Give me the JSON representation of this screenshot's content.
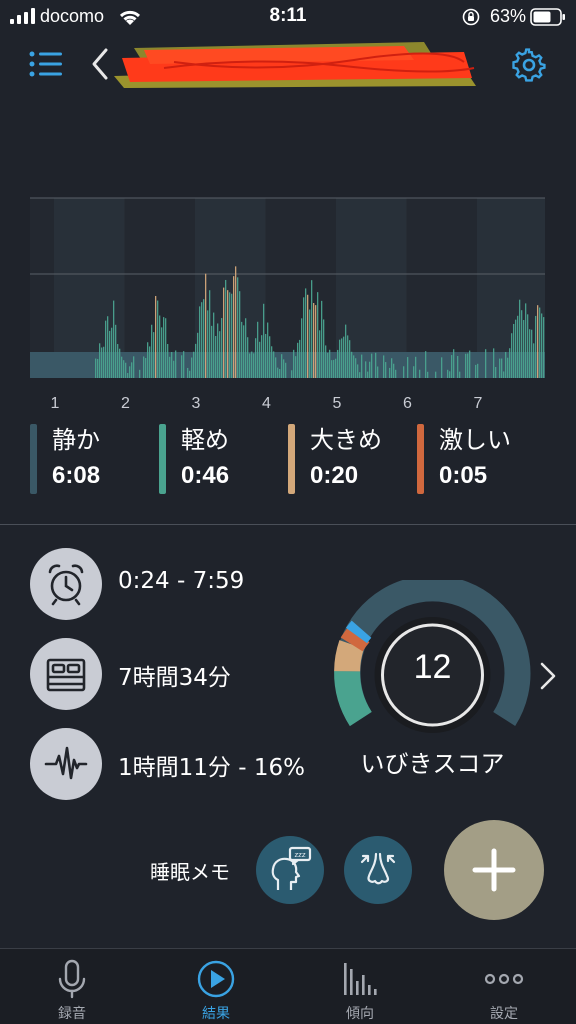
{
  "status_bar": {
    "carrier": "docomo",
    "time": "8:11",
    "battery": "63%"
  },
  "nav": {
    "title": ""
  },
  "chart": {
    "x_ticks": [
      "1",
      "2",
      "3",
      "4",
      "5",
      "6",
      "7"
    ]
  },
  "legend": [
    {
      "label": "静か",
      "value": "6:08",
      "color": "#3a5866"
    },
    {
      "label": "軽め",
      "value": "0:46",
      "color": "#4aa38f"
    },
    {
      "label": "大きめ",
      "value": "0:20",
      "color": "#d3a87a"
    },
    {
      "label": "激しい",
      "value": "0:05",
      "color": "#d0683e"
    }
  ],
  "info": {
    "time_range": "0:24 - 7:59",
    "duration": "7時間34分",
    "snore_time": "1時間11分 - 16%"
  },
  "score": {
    "value": "12",
    "label": "いびきスコア"
  },
  "memo": {
    "label": "睡眠メモ"
  },
  "tabs": [
    {
      "label": "録音"
    },
    {
      "label": "結果"
    },
    {
      "label": "傾向"
    },
    {
      "label": "設定"
    }
  ],
  "colors": {
    "accent": "#3aa3e3",
    "quiet": "#3a5866",
    "light": "#4aa38f",
    "loud": "#d3a87a",
    "epic": "#d0683e",
    "add_button": "#a39e86",
    "memo_button": "#2b5b70"
  }
}
